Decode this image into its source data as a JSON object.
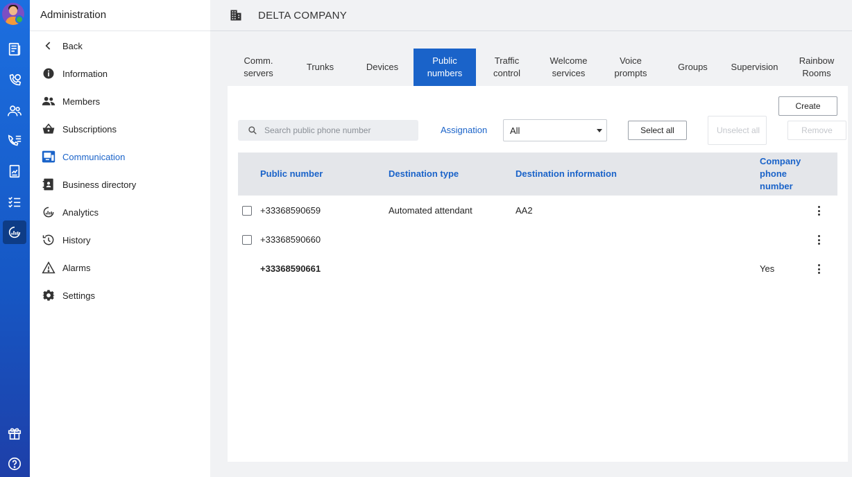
{
  "nav": {
    "title": "Administration",
    "items": [
      {
        "label": "Back"
      },
      {
        "label": "Information"
      },
      {
        "label": "Members"
      },
      {
        "label": "Subscriptions"
      },
      {
        "label": "Communication"
      },
      {
        "label": "Business directory"
      },
      {
        "label": "Analytics"
      },
      {
        "label": "History"
      },
      {
        "label": "Alarms"
      },
      {
        "label": "Settings"
      }
    ],
    "active": "Communication"
  },
  "header": {
    "title": "DELTA COMPANY",
    "icon": "building-icon"
  },
  "tabs": [
    {
      "label": "Comm.\nservers"
    },
    {
      "label": "Trunks"
    },
    {
      "label": "Devices"
    },
    {
      "label": "Public\nnumbers"
    },
    {
      "label": "Traffic\ncontrol"
    },
    {
      "label": "Welcome\nservices"
    },
    {
      "label": "Voice\nprompts"
    },
    {
      "label": "Groups"
    },
    {
      "label": "Supervision"
    },
    {
      "label": "Rainbow\nRooms"
    }
  ],
  "active_tab": "Public numbers",
  "toolbar": {
    "create_label": "Create",
    "search_placeholder": "Search public phone number",
    "assignation_label": "Assignation",
    "assignation_value": "All",
    "select_all_label": "Select all",
    "unselect_all_label": "Unselect all",
    "remove_label": "Remove"
  },
  "table": {
    "columns": [
      "Public number",
      "Destination type",
      "Destination information",
      "Company phone number"
    ],
    "rows": [
      {
        "number": "+33368590659",
        "dest_type": "Automated attendant",
        "dest_info": "AA2",
        "company": ""
      },
      {
        "number": "+33368590660",
        "dest_type": "",
        "dest_info": "",
        "company": ""
      },
      {
        "number": "+33368590661",
        "dest_type": "",
        "dest_info": "",
        "company": "Yes"
      }
    ]
  },
  "colors": {
    "accent": "#1a63c9",
    "rail": "#1c6fe0"
  }
}
